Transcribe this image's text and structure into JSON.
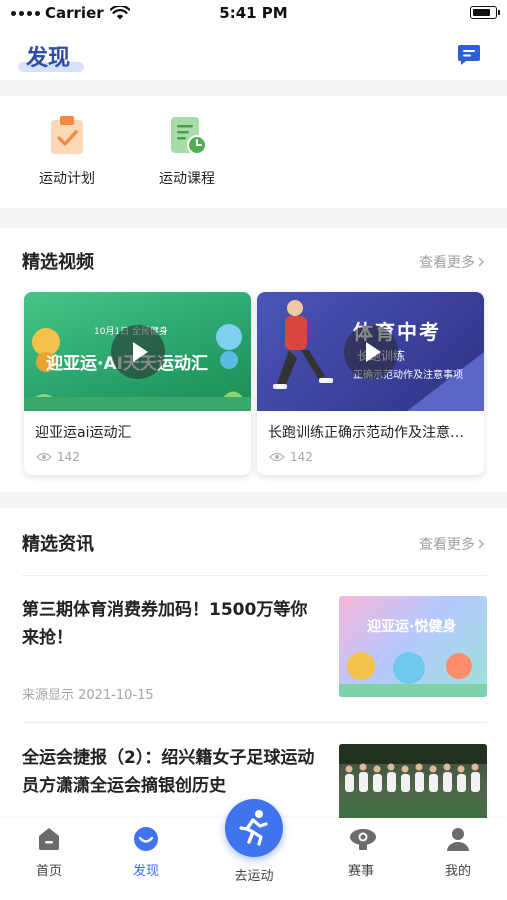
{
  "status_bar": {
    "carrier": "Carrier",
    "time": "5:41 PM"
  },
  "header": {
    "title": "发现",
    "message_icon": "message-icon"
  },
  "quick_entries": [
    {
      "label": "运动计划",
      "icon": "clipboard-check-icon",
      "color": "#f5a15b"
    },
    {
      "label": "运动课程",
      "icon": "document-clock-icon",
      "color": "#5cb85c"
    }
  ],
  "videos": {
    "title": "精选视频",
    "more": "查看更多",
    "items": [
      {
        "title": "迎亚运ai运动汇",
        "views": "142",
        "thumb_text": "迎亚运·AI天天运动汇",
        "thumb_sub": "10月1日 全民健身"
      },
      {
        "title": "长跑训练正确示范动作及注意事项",
        "views": "142",
        "thumb_text": "体育中考",
        "thumb_sub": "长跑训练",
        "thumb_sub2": "正确示范动作及注意事项"
      }
    ]
  },
  "news": {
    "title": "精选资讯",
    "more": "查看更多",
    "items": [
      {
        "title": "第三期体育消费券加码！1500万等你来抢！",
        "source": "来源显示 2021-10-15",
        "thumb_text": "迎亚运·悦健身"
      },
      {
        "title": "全运会捷报（2）：绍兴籍女子足球运动员方潇潇全运会摘银创历史",
        "source": "",
        "thumb_text": ""
      }
    ]
  },
  "tabbar": {
    "items": [
      {
        "label": "首页",
        "icon": "home-icon",
        "active": false
      },
      {
        "label": "发现",
        "icon": "discover-icon",
        "active": true
      },
      {
        "label": "去运动",
        "icon": "running-icon",
        "active": false
      },
      {
        "label": "赛事",
        "icon": "trophy-icon",
        "active": false
      },
      {
        "label": "我的",
        "icon": "user-icon",
        "active": false
      }
    ]
  },
  "colors": {
    "accent": "#3f74ee",
    "title": "#2c4ca6",
    "muted": "#a5a5a5"
  }
}
